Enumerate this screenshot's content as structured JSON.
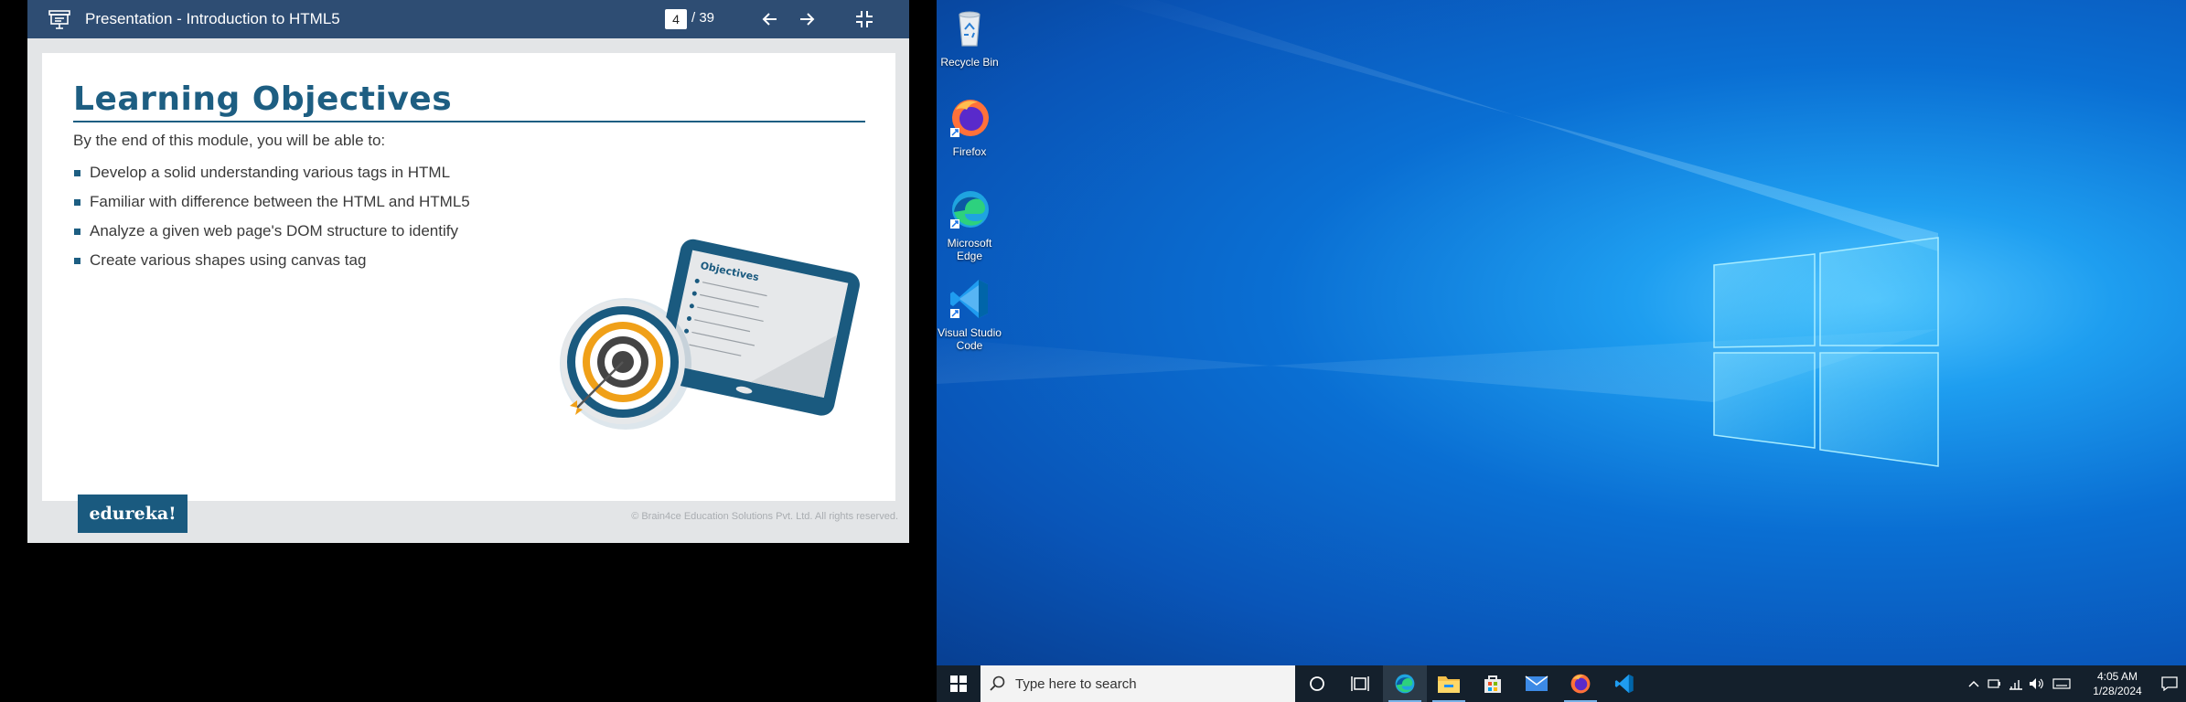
{
  "presentation": {
    "window_title": "Presentation - Introduction to HTML5",
    "current_page": "4",
    "page_total": "/ 39",
    "slide": {
      "title": "Learning Objectives",
      "intro": "By the end of this module, you will be able to:",
      "bullets": [
        "Develop a solid understanding various tags in HTML",
        "Familiar with difference between the HTML and HTML5",
        "Analyze a given web page's DOM structure to identify",
        "Create various shapes using canvas tag"
      ],
      "illustration_heading": "Objectives"
    },
    "brand": "edureka!",
    "copyright": "© Brain4ce Education Solutions Pvt. Ltd. All rights reserved."
  },
  "desktop": {
    "icons": [
      {
        "label": "Recycle Bin",
        "icon": "recycle-bin-icon"
      },
      {
        "label": "Firefox",
        "icon": "firefox-icon"
      },
      {
        "label": "Microsoft Edge",
        "icon": "edge-icon"
      },
      {
        "label": "Visual Studio Code",
        "icon": "vscode-icon"
      }
    ]
  },
  "taskbar": {
    "search_placeholder": "Type here to search",
    "apps": [
      "cortana-icon",
      "task-view-icon",
      "edge-icon",
      "file-explorer-icon",
      "store-icon",
      "mail-icon",
      "firefox-icon",
      "vscode-icon"
    ],
    "time": "4:05 AM",
    "date": "1/28/2024"
  },
  "colors": {
    "toolbar": "#2e4d73",
    "slide_accent": "#1d5e82",
    "taskbar": "#14202c",
    "desktop_blue": "#0a6fd3"
  }
}
